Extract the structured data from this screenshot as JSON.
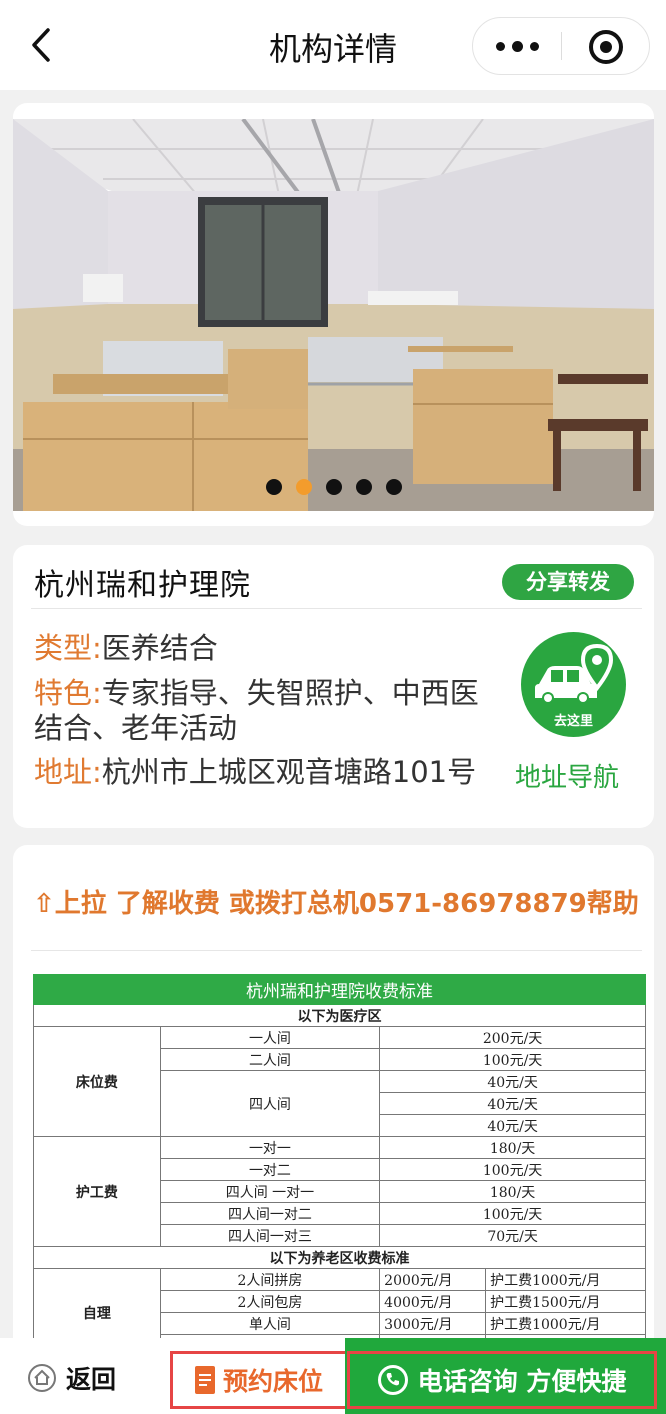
{
  "header": {
    "title": "机构详情",
    "back_icon": "chevron-left-icon",
    "more_icon": "more-dots-icon",
    "close_icon": "target-circle-icon"
  },
  "carousel": {
    "dots_total": 5,
    "active_index": 1
  },
  "institution": {
    "name": "杭州瑞和护理院",
    "share_label": "分享转发",
    "type_label": "类型:",
    "type_value": "医养结合",
    "feature_label": "特色:",
    "feature_value_line1": "专家指导、失智照护、中西医",
    "feature_value_line2": "结合、老年活动",
    "address_label": "地址:",
    "address_value": "杭州市上城区观音塘路101号",
    "go_here_label": "去这里",
    "nav_link": "地址导航"
  },
  "fees": {
    "tip": "⇧上拉 了解收费 或拨打总机0571-86978879帮助",
    "table_title": "杭州瑞和护理院收费标准",
    "medical_section": "以下为医疗区",
    "bed_category": "床位费",
    "bed_rows": [
      {
        "room": "一人间",
        "price": "200元/天"
      },
      {
        "room": "二人间",
        "price": "100元/天"
      },
      {
        "room": "四人间",
        "price": "40元/天"
      },
      {
        "room": "",
        "price": "40元/天"
      },
      {
        "room": "",
        "price": "40元/天"
      }
    ],
    "nursing_category": "护工费",
    "nursing_rows": [
      {
        "room": "一对一",
        "price": "180/天"
      },
      {
        "room": "一对二",
        "price": "100元/天"
      },
      {
        "room": "四人间 一对一",
        "price": "180/天"
      },
      {
        "room": "四人间一对二",
        "price": "100元/天"
      },
      {
        "room": "四人间一对三",
        "price": "70元/天"
      }
    ],
    "elderly_section": "以下为养老区收费标准",
    "self_care_category": "自理",
    "elderly_rows": [
      {
        "room": "2人间拼房",
        "price": "2000元/月",
        "nursing": "护工费1000元/月"
      },
      {
        "room": "2人间包房",
        "price": "4000元/月",
        "nursing": "护工费1500元/月"
      },
      {
        "room": "单人间",
        "price": "3000元/月",
        "nursing": "护工费1000元/月"
      },
      {
        "room": "",
        "price": "",
        "nursing": ""
      }
    ]
  },
  "bottom_bar": {
    "back_label": "返回",
    "book_label": "预约床位",
    "call_label": "电话咨询 方便快捷"
  },
  "colors": {
    "accent_green": "#2aa640",
    "label_orange": "#e07a31",
    "highlight_red": "#e64545"
  }
}
